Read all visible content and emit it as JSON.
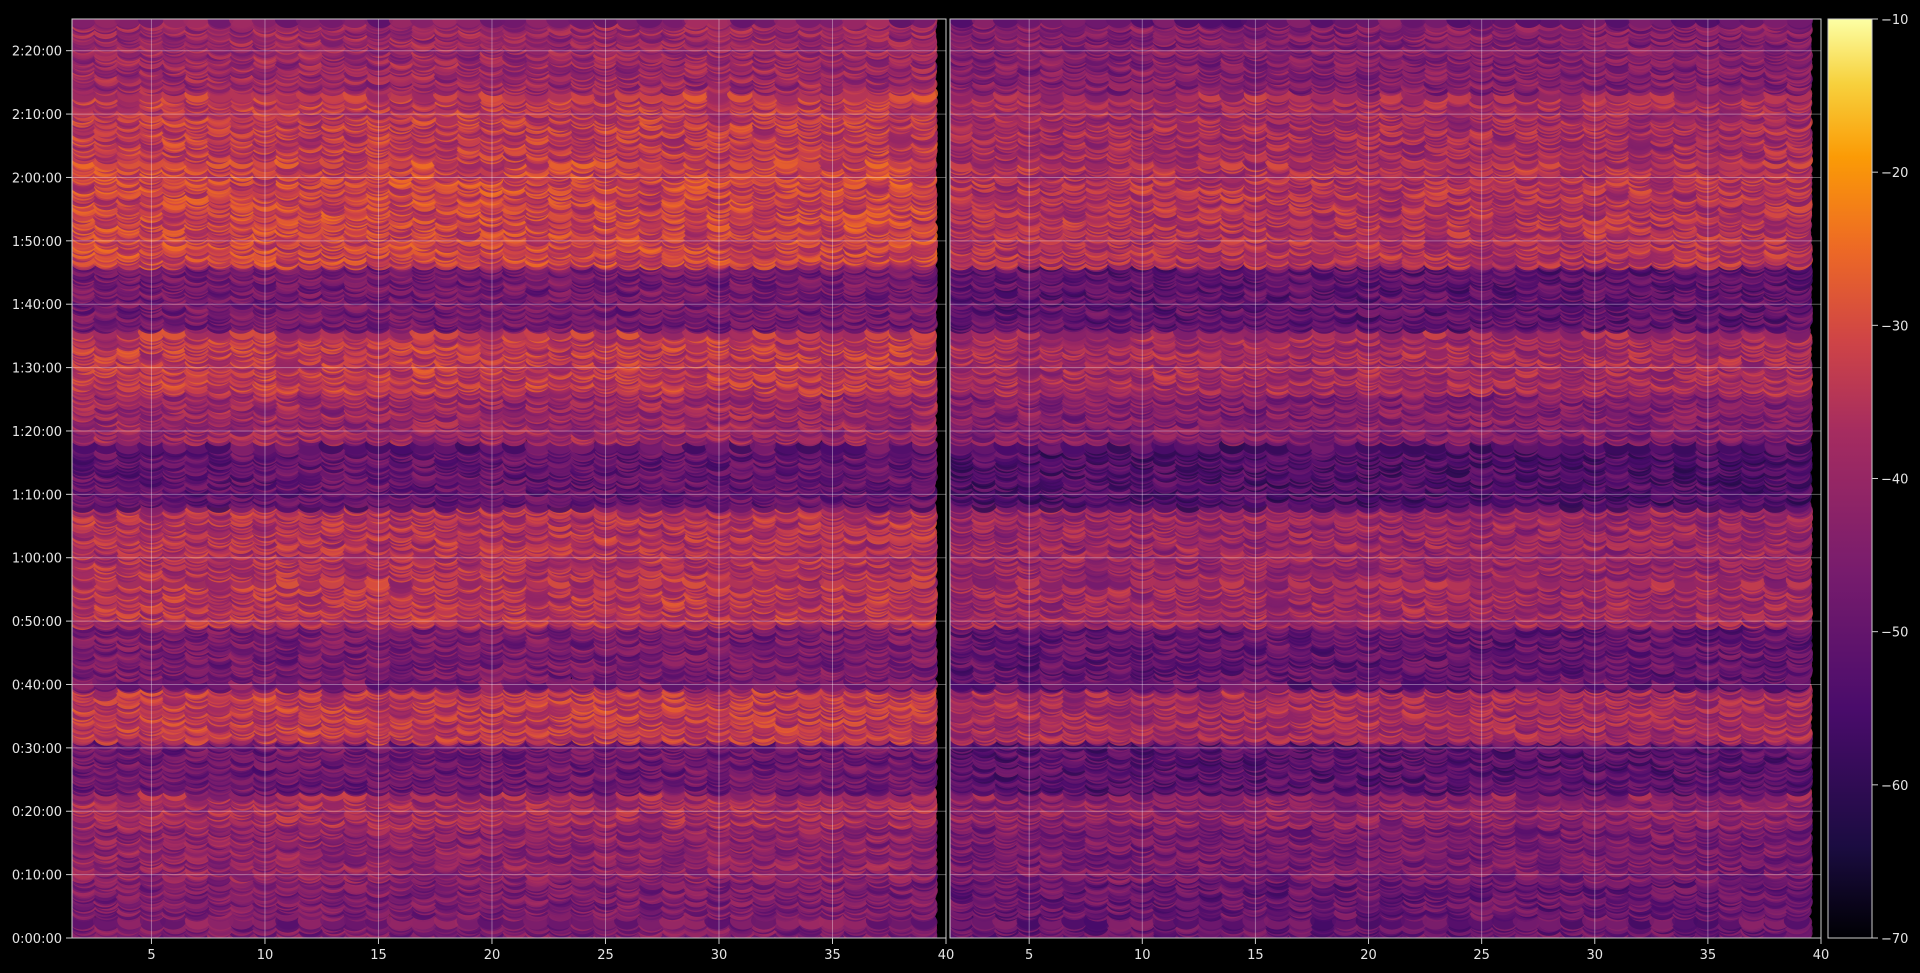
{
  "chart_data": {
    "type": "heatmap",
    "title": "",
    "xlabel": "",
    "ylabel": "",
    "colormap": "inferno",
    "background": "#000000",
    "grid": true,
    "panels": [
      {
        "name": "",
        "xlim": [
          1.5,
          40
        ],
        "xticks": [
          5,
          10,
          15,
          20,
          25,
          30,
          35,
          40
        ],
        "channels": 38
      },
      {
        "name": "",
        "xlim": [
          1.5,
          40
        ],
        "xticks": [
          5,
          10,
          15,
          20,
          25,
          30,
          35,
          40
        ],
        "channels": 38
      }
    ],
    "y": {
      "unit": "elapsed time",
      "range_seconds": [
        0,
        8700
      ],
      "tick_seconds": [
        0,
        600,
        1200,
        1800,
        2400,
        3000,
        3600,
        4200,
        4800,
        5400,
        6000,
        6600,
        7200,
        7800,
        8400
      ],
      "tick_labels": [
        "0:00:00",
        "0:10:00",
        "0:20:00",
        "0:30:00",
        "0:40:00",
        "0:50:00",
        "1:00:00",
        "1:10:00",
        "1:20:00",
        "1:30:00",
        "1:40:00",
        "1:50:00",
        "2:00:00",
        "2:10:00",
        "2:20:00"
      ]
    },
    "colorbar": {
      "ticks": [
        -10,
        -20,
        -30,
        -40,
        -50,
        -60,
        -70
      ],
      "tick_labels": [
        "−10",
        "−20",
        "−30",
        "−40",
        "−50",
        "−60",
        "−70"
      ],
      "range": [
        -70,
        -10
      ]
    },
    "gaps_seconds": [
      [
        170,
        230
      ],
      [
        1390,
        1420
      ],
      [
        2440,
        2480
      ],
      [
        3400,
        3440
      ],
      [
        4120,
        4150
      ],
      [
        4680,
        4730
      ],
      [
        5760,
        5800
      ],
      [
        7370,
        7400
      ],
      [
        8010,
        8050
      ]
    ],
    "bands": [
      {
        "from": 0,
        "to": 600,
        "level": -45
      },
      {
        "from": 600,
        "to": 1100,
        "level": -42
      },
      {
        "from": 1100,
        "to": 1400,
        "level": -38
      },
      {
        "from": 1400,
        "to": 1900,
        "level": -48
      },
      {
        "from": 1900,
        "to": 2400,
        "level": -34
      },
      {
        "from": 2400,
        "to": 3000,
        "level": -46
      },
      {
        "from": 3000,
        "to": 3400,
        "level": -35
      },
      {
        "from": 3400,
        "to": 4100,
        "level": -36
      },
      {
        "from": 4100,
        "to": 4700,
        "level": -50
      },
      {
        "from": 4700,
        "to": 5200,
        "level": -40
      },
      {
        "from": 5200,
        "to": 5800,
        "level": -34
      },
      {
        "from": 5800,
        "to": 6400,
        "level": -47
      },
      {
        "from": 6400,
        "to": 7400,
        "level": -32
      },
      {
        "from": 7400,
        "to": 8000,
        "level": -34
      },
      {
        "from": 8000,
        "to": 8700,
        "level": -40
      }
    ]
  }
}
